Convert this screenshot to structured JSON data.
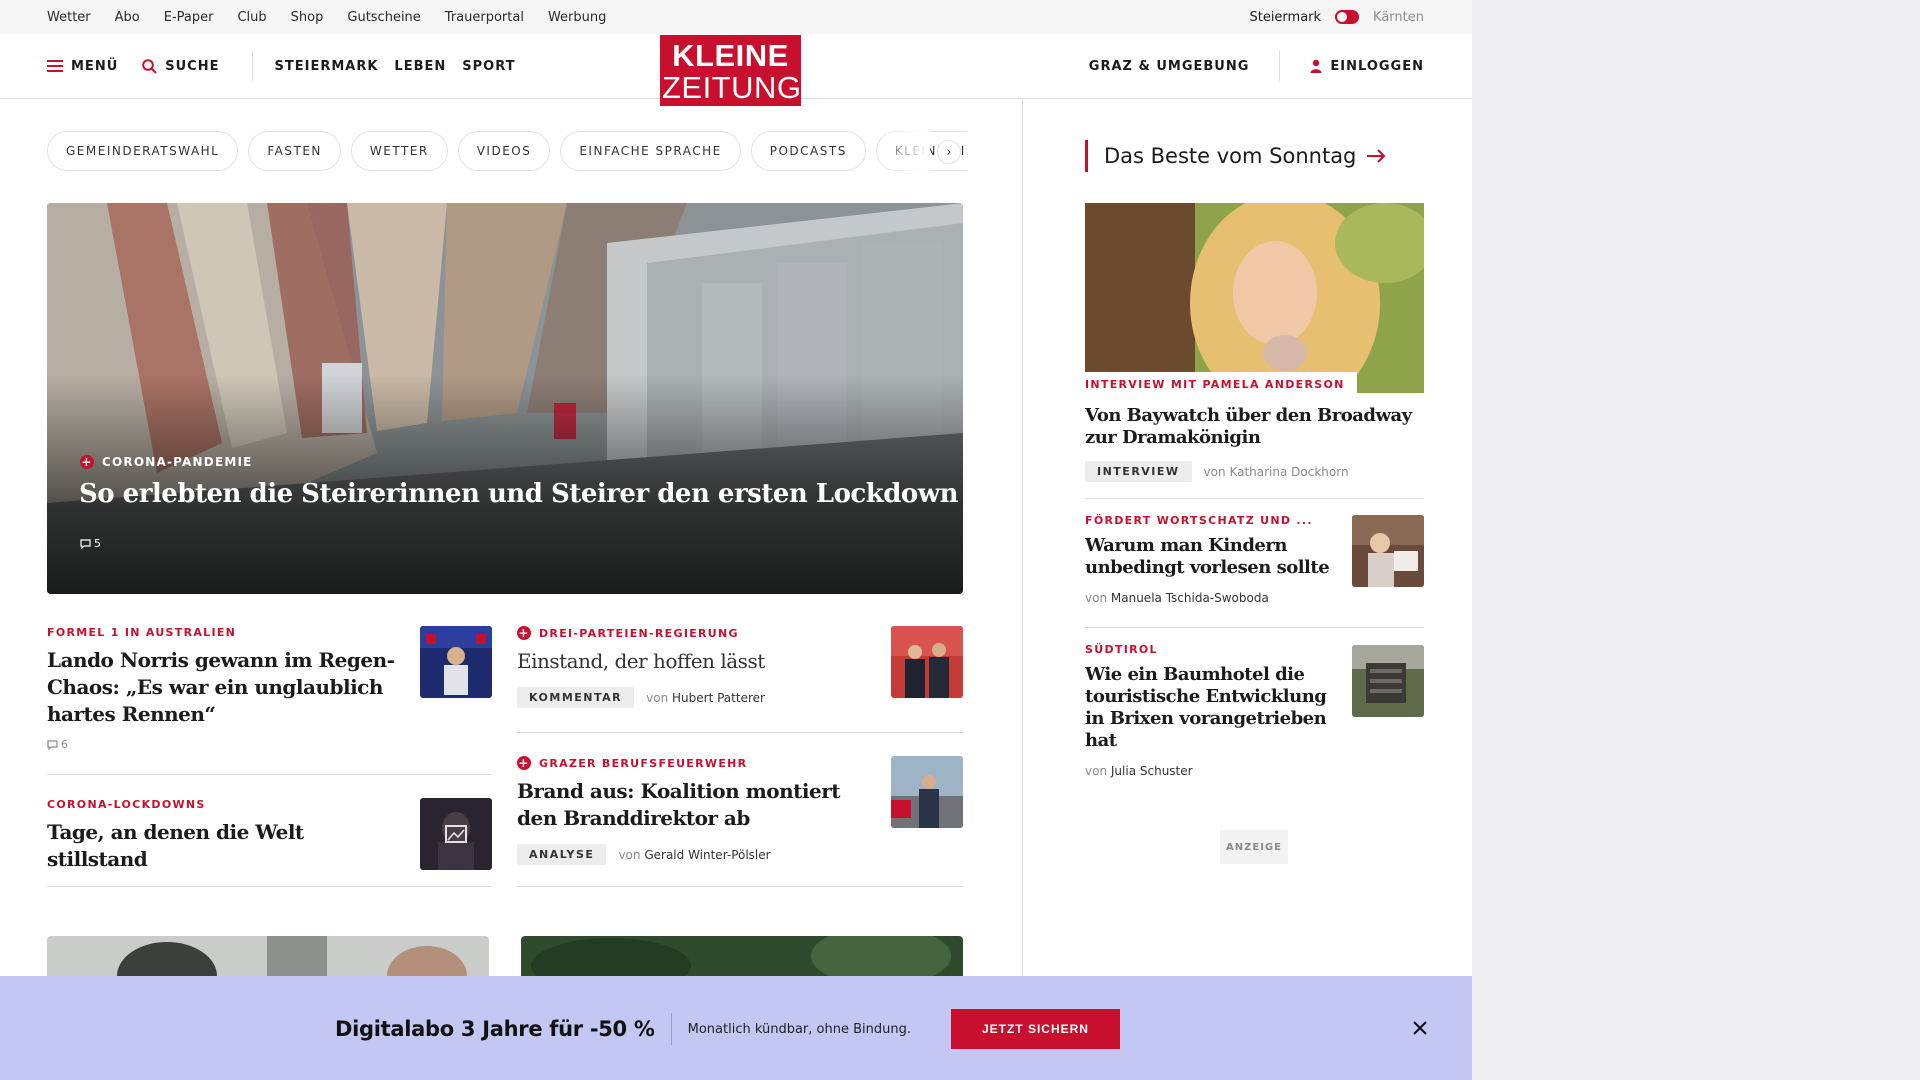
{
  "utility": {
    "links": [
      "Wetter",
      "Abo",
      "E-Paper",
      "Club",
      "Shop",
      "Gutscheine",
      "Trauerportal",
      "Werbung"
    ],
    "region_active": "Steiermark",
    "region_inactive": "Kärnten"
  },
  "header": {
    "menu_label": "MENÜ",
    "search_label": "SUCHE",
    "nav": [
      "STEIERMARK",
      "LEBEN",
      "SPORT"
    ],
    "logo_line1": "KLEINE",
    "logo_line2": "ZEITUNG",
    "region_label": "GRAZ & UMGEBUNG",
    "login_label": "EINLOGGEN"
  },
  "chips": [
    "GEMEINDERATSWAHL",
    "FASTEN",
    "WETTER",
    "VIDEOS",
    "EINFACHE SPRACHE",
    "PODCASTS",
    "KLEINE KINDE"
  ],
  "hero": {
    "kicker": "CORONA-PANDEMIE",
    "title": "So erlebten die Steirerinnen und Steirer den ersten Lockdown",
    "comments": "5"
  },
  "teasers_left": [
    {
      "kicker": "FORMEL 1 IN AUSTRALIEN",
      "title": "Lando Norris gewann im Regen-Chaos: „Es war ein unglaublich hartes Rennen“",
      "comments": "6"
    },
    {
      "kicker": "CORONA-LOCKDOWNS",
      "title": "Tage, an denen die Welt stillstand"
    }
  ],
  "teasers_right": [
    {
      "kicker": "DREI-PARTEIEN-REGIERUNG",
      "title": "Einstand, der hoffen lässt",
      "tag": "KOMMENTAR",
      "by_prefix": "von",
      "author": "Hubert Patterer"
    },
    {
      "kicker": "GRAZER BERUFSFEUERWEHR",
      "title": "Brand aus: Koalition montiert den Branddirektor ab",
      "tag": "ANALYSE",
      "by_prefix": "von",
      "author": "Gerald Winter-Pölsler"
    }
  ],
  "sidebar": {
    "title": "Das Beste vom Sonntag",
    "items": [
      {
        "kicker": "INTERVIEW MIT PAMELA ANDERSON",
        "title": "Von Baywatch über den Broadway zur Dramakönigin",
        "tag": "INTERVIEW",
        "by_prefix": "von",
        "author": "Katharina Dockhorn"
      },
      {
        "kicker": "FÖRDERT WORTSCHATZ UND ...",
        "title": "Warum man Kindern unbedingt vorlesen sollte",
        "by_prefix": "von",
        "author": "Manuela Tschida-Swoboda"
      },
      {
        "kicker": "SÜDTIROL",
        "title": "Wie ein Baumhotel die touristische Entwicklung in Brixen vorangetrieben hat",
        "by_prefix": "von",
        "author": "Julia Schuster"
      }
    ],
    "ad_label": "ANZEIGE"
  },
  "banner": {
    "title": "Digitalabo 3 Jahre für -50 %",
    "text": "Monatlich kündbar, ohne Bindung.",
    "button": "JETZT SICHERN"
  },
  "colors": {
    "brand_red": "#c8102e",
    "banner_bg": "#c2c7f3"
  }
}
